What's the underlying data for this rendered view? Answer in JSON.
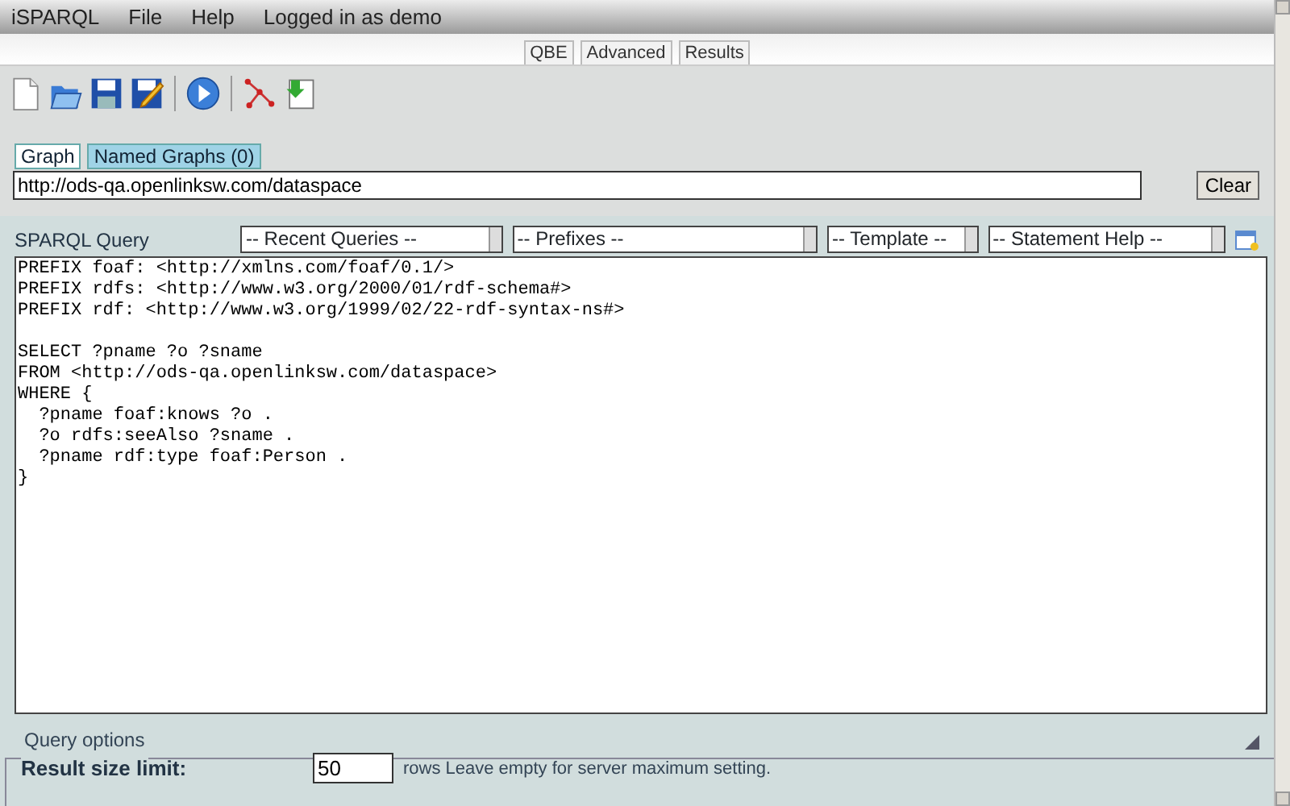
{
  "menu": [
    "iSPARQL",
    "File",
    "Help",
    "Logged in as demo"
  ],
  "view_tabs": [
    {
      "label": "QBE",
      "selected": false
    },
    {
      "label": "Advanced",
      "selected": false
    },
    {
      "label": "Results",
      "selected": false
    }
  ],
  "toolbar": [
    {
      "kind": "new"
    },
    {
      "kind": "open"
    },
    {
      "kind": "save"
    },
    {
      "kind": "save-as"
    },
    {
      "kind": "sep"
    },
    {
      "kind": "run"
    },
    {
      "kind": "sep"
    },
    {
      "kind": "graph"
    },
    {
      "kind": "import"
    }
  ],
  "graph_tabs": [
    {
      "label": "Graph",
      "selected": true
    },
    {
      "label": "Named Graphs (0)",
      "selected": false
    }
  ],
  "graph_field": {
    "value": "http://ods-qa.openlinksw.com/dataspace"
  },
  "clear_button": "Clear",
  "query_label": "SPARQL Query",
  "dropdowns": [
    "-- Recent Queries --",
    "-- Prefixes --",
    "-- Template --",
    "-- Statement Help --"
  ],
  "query": "PREFIX foaf: <http://xmlns.com/foaf/0.1/>\nPREFIX rdfs: <http://www.w3.org/2000/01/rdf-schema#>\nPREFIX rdf: <http://www.w3.org/1999/02/22-rdf-syntax-ns#>\n\nSELECT ?pname ?o ?sname\nFROM <http://ods-qa.openlinksw.com/dataspace>\nWHERE {\n  ?pname foaf:knows ?o .\n  ?o rdfs:seeAlso ?sname .\n  ?pname rdf:type foaf:Person .\n}",
  "query_options": {
    "legend": "Query options",
    "limit_label": "Result size limit:",
    "limit_value": "50",
    "limit_hint": "rows Leave empty for server maximum setting."
  }
}
